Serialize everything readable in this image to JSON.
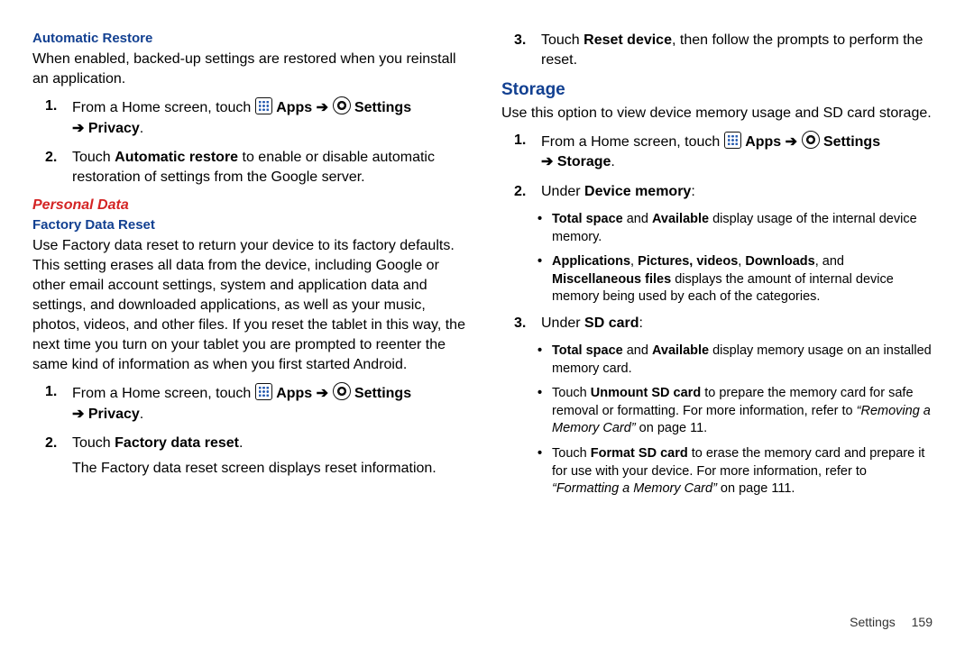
{
  "left": {
    "automatic_restore": {
      "head": "Automatic Restore",
      "body": "When enabled, backed-up settings are restored when you reinstall an application.",
      "step1_pre": "From a Home screen, touch ",
      "apps_label": "Apps",
      "arrow": "➔",
      "settings_label": "Settings",
      "privacy_line": "➔ Privacy",
      "period": ".",
      "step2": "Touch ",
      "step2_bold": "Automatic restore",
      "step2_rest": " to enable or disable automatic restoration of settings from the Google server."
    },
    "personal_data": {
      "head": "Personal Data",
      "sub": "Factory Data Reset",
      "body": "Use Factory data reset to return your device to its factory defaults. This setting erases all data from the device, including Google or other email account settings, system and application data and settings, and downloaded applications, as well as your music, photos, videos, and other files. If you reset the tablet in this way, the next time you turn on your tablet you are prompted to reenter the same kind of information as when you first started Android.",
      "step1_pre": "From a Home screen, touch ",
      "step2_pre": "Touch ",
      "step2_bold": "Factory data reset",
      "step2_post": ".",
      "step2_info": "The Factory data reset screen displays reset information."
    }
  },
  "right": {
    "step3_pre": "Touch ",
    "step3_bold": "Reset device",
    "step3_post": ", then follow the prompts to perform the reset.",
    "storage": {
      "head": "Storage",
      "body": "Use this option to view device memory usage and SD card storage.",
      "step1_pre": "From a Home screen, touch ",
      "apps_label": "Apps",
      "arrow": "➔",
      "settings_label": "Settings",
      "storage_line": "➔ Storage",
      "period": ".",
      "step2_pre": "Under ",
      "step2_bold": "Device memory",
      "step2_post": ":",
      "b1_a": "Total space",
      "b1_b": " and ",
      "b1_c": "Available",
      "b1_d": " display usage of the internal device memory.",
      "b2_a": "Applications",
      "b2_b": ", ",
      "b2_c": "Pictures, videos",
      "b2_d": ", ",
      "b2_e": "Downloads",
      "b2_f": ", and ",
      "b2_g": "Miscellaneous files",
      "b2_h": " displays the amount of internal device memory being used by each of the categories.",
      "step3_pre": "Under ",
      "step3_bold": "SD card",
      "step3_post": ":",
      "c1_a": "Total space",
      "c1_b": " and ",
      "c1_c": "Available",
      "c1_d": " display memory usage on an installed memory card.",
      "c2_a": "Touch ",
      "c2_b": "Unmount SD card",
      "c2_c": " to prepare the memory card for safe removal or formatting. For more information, refer to ",
      "c2_d": "“Removing a Memory Card”",
      "c2_e": " on page 11.",
      "c3_a": "Touch ",
      "c3_b": "Format SD card",
      "c3_c": " to erase the memory card and prepare it for use with your device. For more information, refer to ",
      "c3_d": "“Formatting a Memory Card”",
      "c3_e": " on page 111."
    }
  },
  "footer": {
    "chapter": "Settings",
    "page": "159"
  }
}
